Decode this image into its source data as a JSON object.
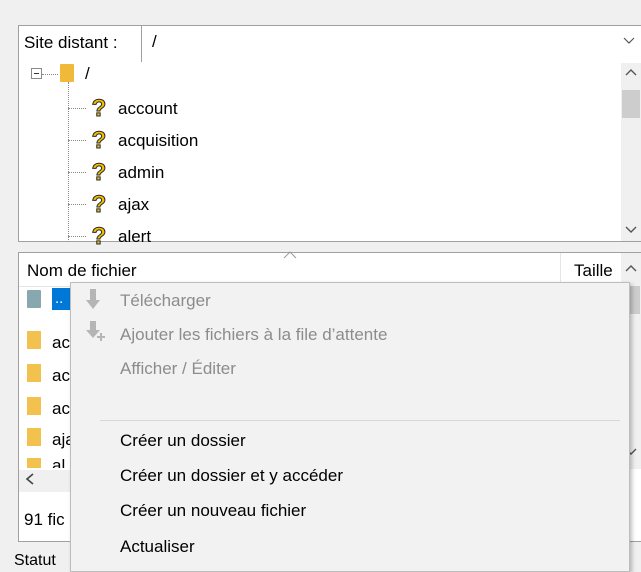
{
  "remote": {
    "label": "Site distant :",
    "path": "/"
  },
  "tree": {
    "root": "/",
    "items": [
      {
        "label": "account"
      },
      {
        "label": "acquisition"
      },
      {
        "label": "admin"
      },
      {
        "label": "ajax"
      },
      {
        "label": "alert"
      }
    ]
  },
  "filelist": {
    "headers": {
      "name": "Nom de fichier",
      "size": "Taille"
    },
    "parent": "..",
    "rows": [
      {
        "label": "ac"
      },
      {
        "label": "ac"
      },
      {
        "label": "ac"
      },
      {
        "label": "aja"
      },
      {
        "label": "al"
      }
    ],
    "count_text": "91 fic"
  },
  "status_label": "Statut",
  "context_menu": {
    "items": [
      {
        "label": "Télécharger",
        "enabled": false
      },
      {
        "label": "Ajouter les fichiers à la file d’attente",
        "enabled": false
      },
      {
        "label": "Afficher / Éditer",
        "enabled": false
      },
      {
        "label": "Créer un dossier",
        "enabled": true
      },
      {
        "label": "Créer un dossier et y accéder",
        "enabled": true
      },
      {
        "label": "Créer un nouveau fichier",
        "enabled": true
      },
      {
        "label": "Actualiser",
        "enabled": true
      }
    ]
  },
  "icons": {
    "unknown": "question-mark-icon",
    "folder": "folder-icon",
    "download": "download-arrow-icon",
    "queue": "add-to-queue-icon"
  },
  "colors": {
    "selection": "#0078d7",
    "folder": "#f2c14e",
    "question": "#f2bf00"
  }
}
